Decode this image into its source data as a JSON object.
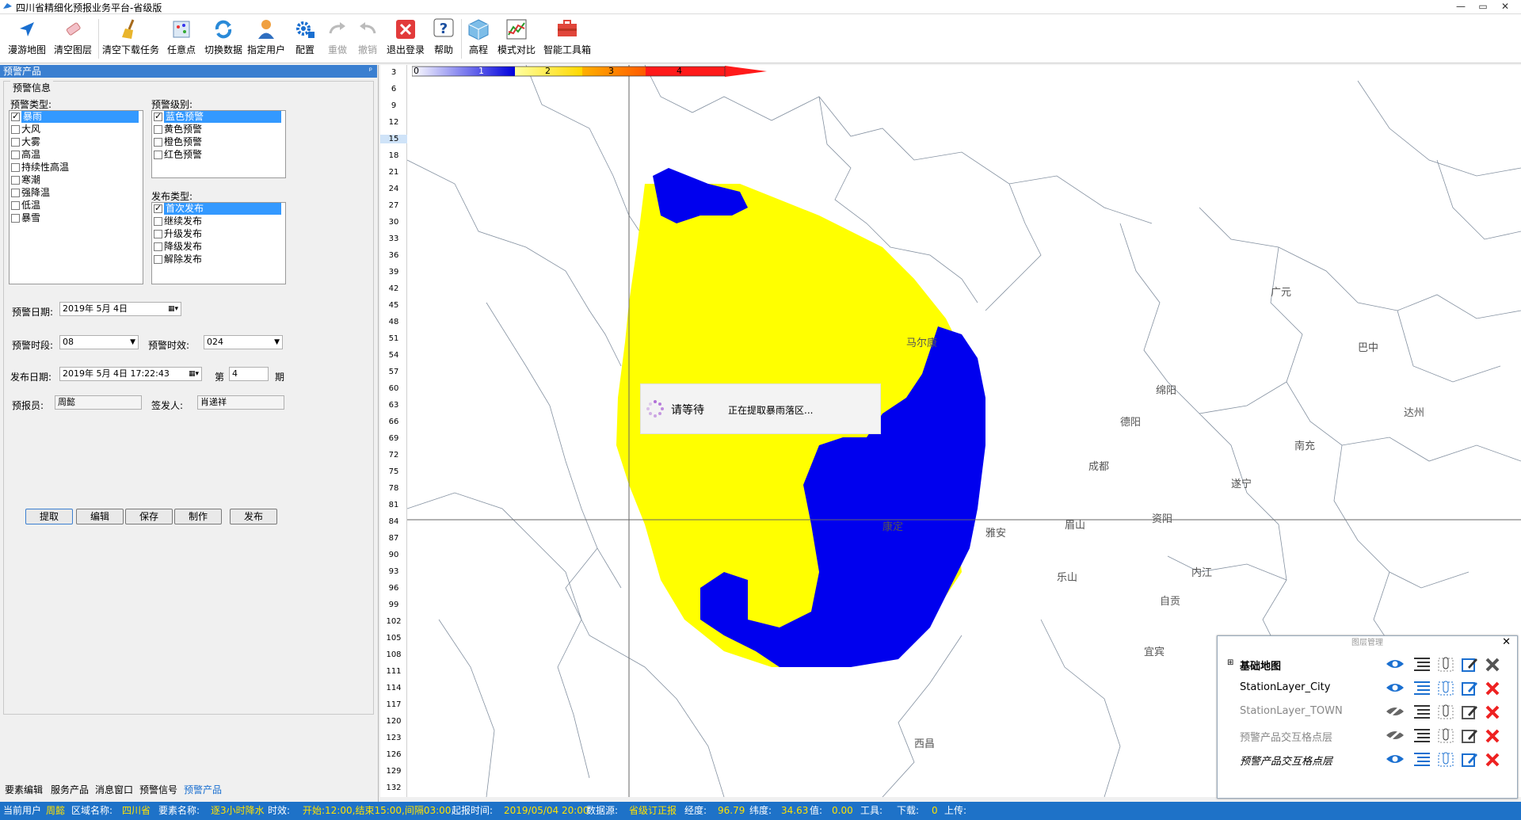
{
  "window": {
    "title": "四川省精细化预报业务平台-省级版"
  },
  "toolbar": {
    "items": [
      {
        "label": "漫游地图",
        "icon": "cursor-arrow-icon"
      },
      {
        "label": "清空图层",
        "icon": "eraser-icon"
      },
      {
        "label": "清空下载任务",
        "icon": "broom-icon"
      },
      {
        "label": "任意点",
        "icon": "point-grid-icon"
      },
      {
        "label": "切换数据",
        "icon": "refresh-icon"
      },
      {
        "label": "指定用户",
        "icon": "user-icon"
      },
      {
        "label": "配置",
        "icon": "settings-icon"
      },
      {
        "label": "重做",
        "icon": "redo-icon"
      },
      {
        "label": "撤销",
        "icon": "undo-icon"
      },
      {
        "label": "退出登录",
        "icon": "logout-icon"
      },
      {
        "label": "帮助",
        "icon": "help-icon"
      },
      {
        "label": "高程",
        "icon": "elevation-cube-icon"
      },
      {
        "label": "模式对比",
        "icon": "chart-compare-icon"
      },
      {
        "label": "智能工具箱",
        "icon": "toolbox-icon"
      }
    ]
  },
  "panel": {
    "title": "预警产品",
    "group_title": "预警信息",
    "warning_type_label": "预警类型:",
    "warning_types": [
      "暴雨",
      "大风",
      "大雾",
      "高温",
      "持续性高温",
      "寒潮",
      "强降温",
      "低温",
      "暴雪"
    ],
    "warning_level_label": "预警级别:",
    "warning_levels": [
      "蓝色预警",
      "黄色预警",
      "橙色预警",
      "红色预警"
    ],
    "publish_type_label": "发布类型:",
    "publish_types": [
      "首次发布",
      "继续发布",
      "升级发布",
      "降级发布",
      "解除发布"
    ],
    "warn_date_label": "预警日期:",
    "warn_date": "2019年 5月 4日",
    "warn_period_label": "预警时段:",
    "warn_period": "08",
    "warn_valid_label": "预警时效:",
    "warn_valid": "024",
    "publish_date_label": "发布日期:",
    "publish_date": "2019年 5月 4日 17:22:43",
    "issue_no_prefix": "第",
    "issue_no": "4",
    "issue_no_suffix": "期",
    "forecaster_label": "预报员:",
    "forecaster": "周懿",
    "signer_label": "签发人:",
    "signer": "肖递祥",
    "buttons": [
      "提取",
      "编辑",
      "保存",
      "制作",
      "发布"
    ]
  },
  "bottom_tabs": [
    "要素编辑",
    "服务产品",
    "消息窗口",
    "预警信号",
    "预警产品"
  ],
  "ruler": [
    "3",
    "6",
    "9",
    "12",
    "15",
    "18",
    "21",
    "24",
    "27",
    "30",
    "33",
    "36",
    "39",
    "42",
    "45",
    "48",
    "51",
    "54",
    "57",
    "60",
    "63",
    "66",
    "69",
    "72",
    "75",
    "78",
    "81",
    "84",
    "87",
    "90",
    "93",
    "96",
    "99",
    "102",
    "105",
    "108",
    "111",
    "114",
    "117",
    "120",
    "123",
    "126",
    "129",
    "132"
  ],
  "colorbar": {
    "labels": [
      "0",
      "1",
      "2",
      "3",
      "4"
    ]
  },
  "map": {
    "city_labels": [
      "马尔康",
      "康定",
      "雅安",
      "眉山",
      "乐山",
      "西昌",
      "绵阳",
      "德阳",
      "成都",
      "遂宁",
      "南充",
      "巴中",
      "达州",
      "广元",
      "资阳",
      "内江",
      "自贡",
      "宜宾"
    ]
  },
  "wait_dialog": {
    "title": "请等待",
    "message": "正在提取暴雨落区..."
  },
  "layers": {
    "title": "图层管理",
    "items": [
      "基础地图",
      "StationLayer_City",
      "StationLayer_TOWN",
      "预警产品交互格点层",
      "预警产品交互格点层"
    ]
  },
  "status": {
    "user_label": "当前用户",
    "user": "周懿",
    "region_label": "区域名称:",
    "region": "四川省",
    "element_label": "要素名称:",
    "element": "逐3小时降水",
    "period_label": "时效:",
    "period": "开始:12:00,结束15:00,间隔03:00",
    "start_label": "起报时间:",
    "start": "2019/05/04 20:00",
    "source_label": "数据源:",
    "source": "省级订正报",
    "lon_label": "经度:",
    "lon": "96.79",
    "lat_label": "纬度:",
    "lat": "34.63",
    "value_label": "值:",
    "value": "0.00",
    "tool_label": "工具:",
    "download_label": "下载:",
    "download": "0",
    "upload_label": "上传:"
  },
  "colors": {
    "blue": "#0000ee",
    "yellow": "#ffff00",
    "accent": "#1e72c8"
  }
}
